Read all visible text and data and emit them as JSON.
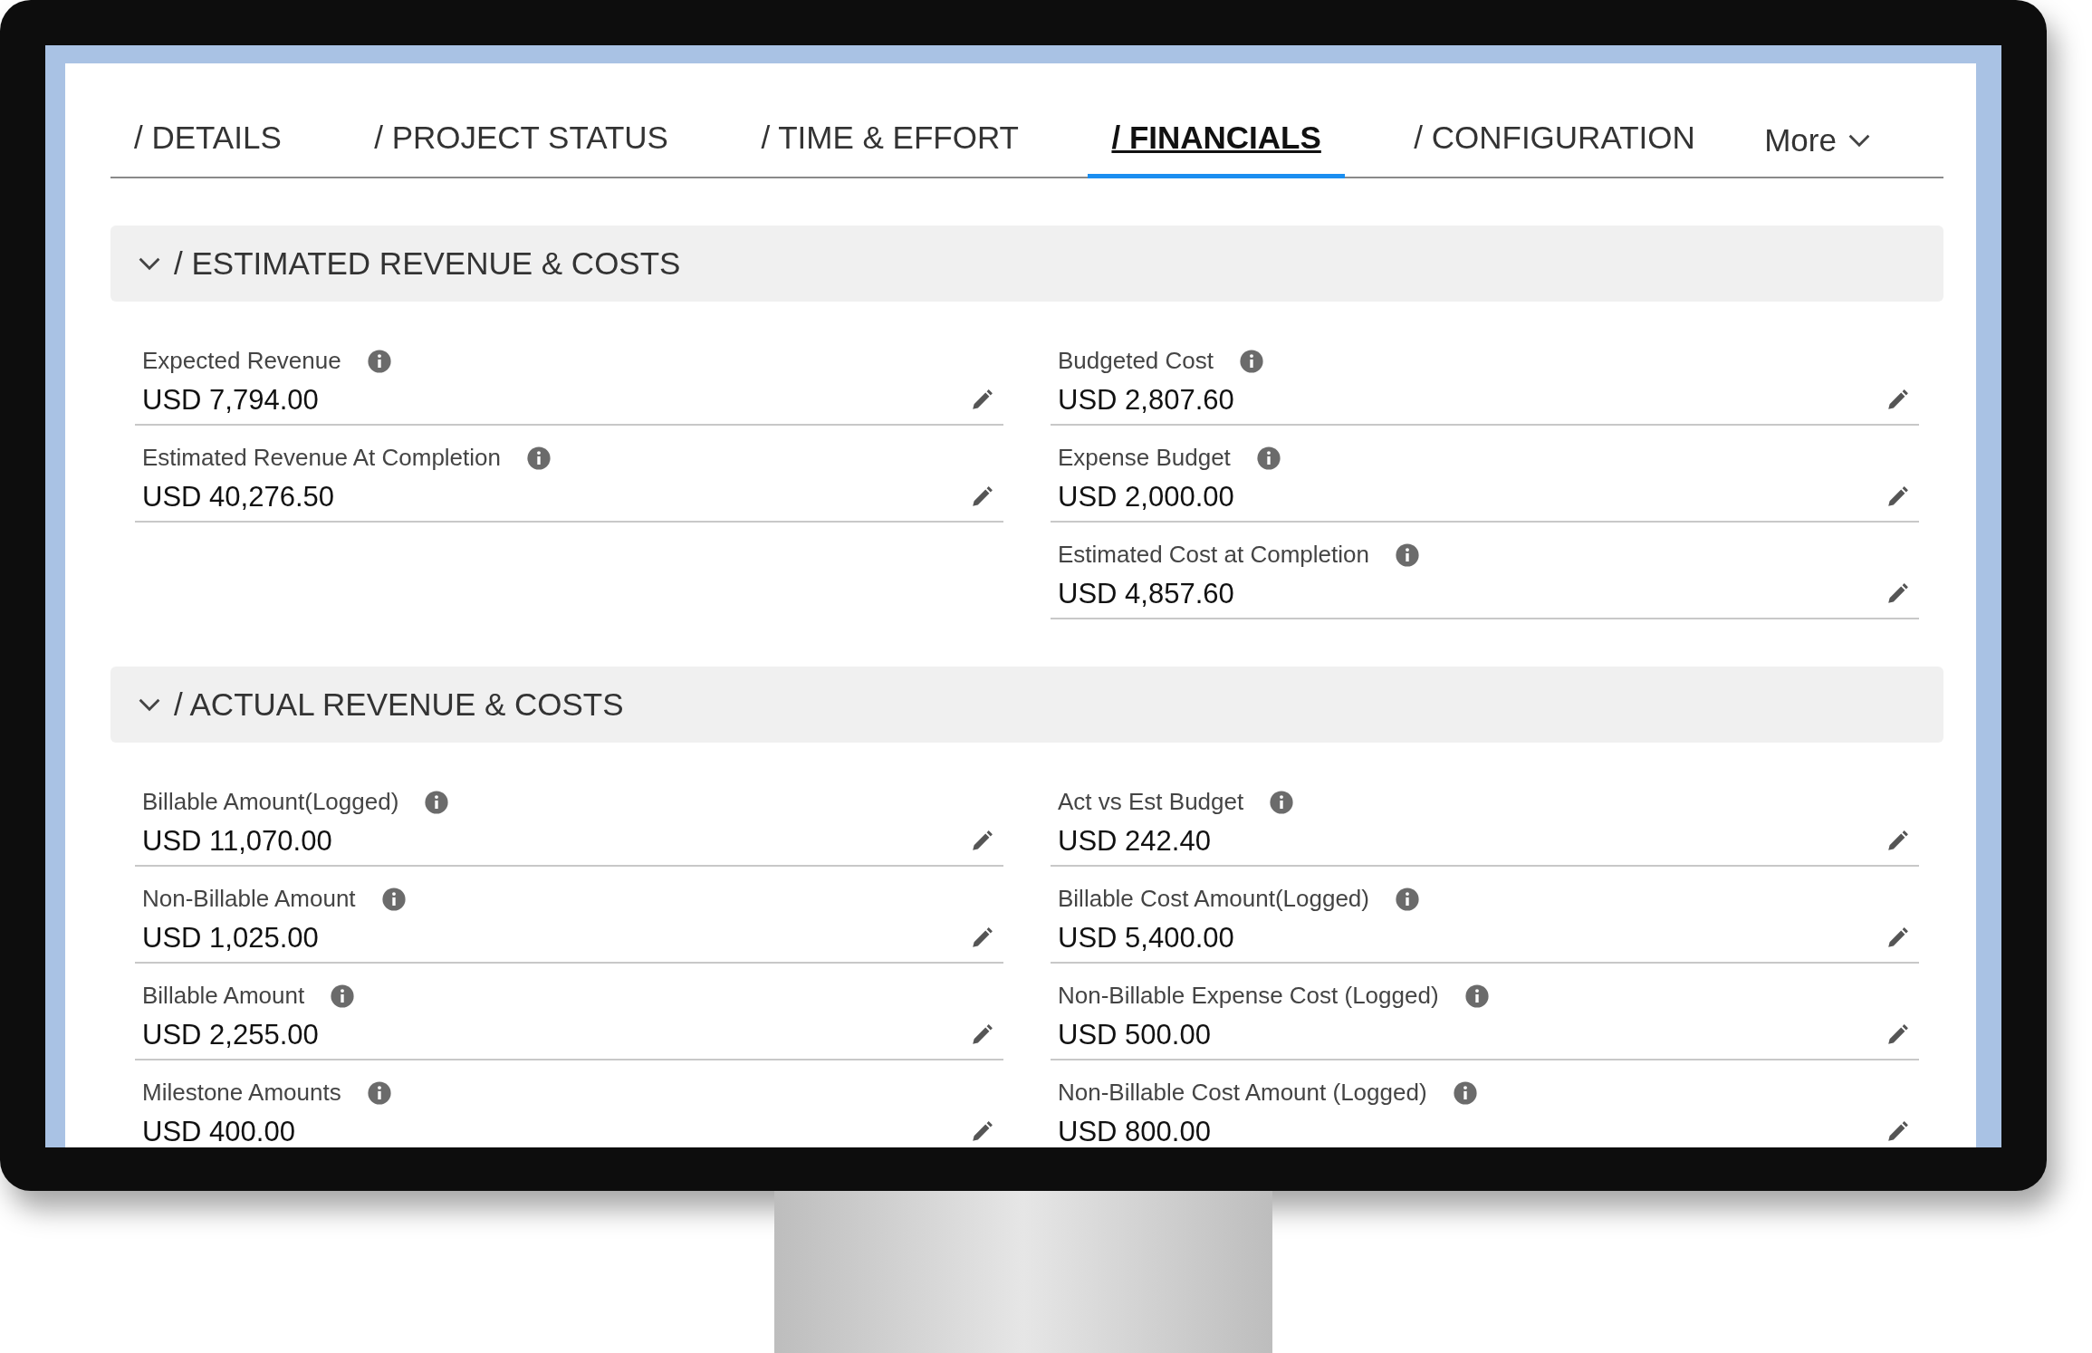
{
  "tabs": [
    {
      "label": "/ DETAILS",
      "selected": false
    },
    {
      "label": "/ PROJECT STATUS",
      "selected": false
    },
    {
      "label": "/ TIME & EFFORT",
      "selected": false
    },
    {
      "label": "/ FINANCIALS",
      "selected": true
    },
    {
      "label": "/ CONFIGURATION",
      "selected": false
    }
  ],
  "more": {
    "label": "More"
  },
  "sections": [
    {
      "title": "/ ESTIMATED REVENUE & COSTS",
      "expanded": true,
      "left": [
        {
          "label": "Expected Revenue",
          "value": "USD 7,794.00"
        },
        {
          "label": "Estimated Revenue At Completion",
          "value": "USD 40,276.50"
        }
      ],
      "right": [
        {
          "label": "Budgeted Cost",
          "value": "USD 2,807.60"
        },
        {
          "label": "Expense Budget",
          "value": "USD 2,000.00"
        },
        {
          "label": "Estimated Cost at Completion",
          "value": "USD 4,857.60"
        }
      ]
    },
    {
      "title": "/ ACTUAL REVENUE & COSTS",
      "expanded": true,
      "left": [
        {
          "label": "Billable Amount(Logged)",
          "value": "USD 11,070.00"
        },
        {
          "label": "Non-Billable Amount",
          "value": "USD 1,025.00"
        },
        {
          "label": "Billable Amount",
          "value": "USD 2,255.00"
        },
        {
          "label": "Milestone Amounts",
          "value": "USD 400.00"
        }
      ],
      "right": [
        {
          "label": "Act vs Est Budget",
          "value": "USD 242.40"
        },
        {
          "label": "Billable Cost Amount(Logged)",
          "value": "USD 5,400.00"
        },
        {
          "label": "Non-Billable Expense Cost (Logged)",
          "value": "USD 500.00"
        },
        {
          "label": "Non-Billable Cost Amount (Logged)",
          "value": "USD 800.00"
        }
      ]
    }
  ]
}
